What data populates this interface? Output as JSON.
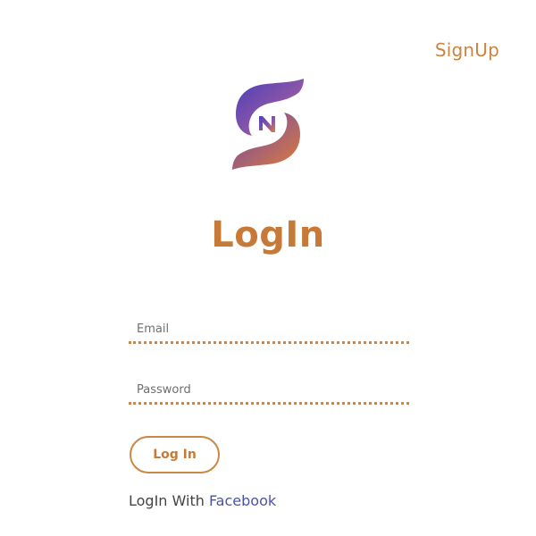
{
  "header": {
    "signup_label": "SignUp"
  },
  "logo": {
    "icon": "brand-s-n-logo-icon",
    "letter": "N",
    "colors": {
      "gradient_start": "#4b3fb8",
      "gradient_end": "#e07c3a"
    }
  },
  "main": {
    "title": "LogIn"
  },
  "form": {
    "email": {
      "placeholder": "Email",
      "value": ""
    },
    "password": {
      "placeholder": "Password",
      "value": ""
    },
    "login_button_label": "Log In"
  },
  "social": {
    "prefix": "LogIn With ",
    "provider_label": "Facebook"
  },
  "colors": {
    "accent": "#cc8441",
    "link": "#4a52a8"
  }
}
